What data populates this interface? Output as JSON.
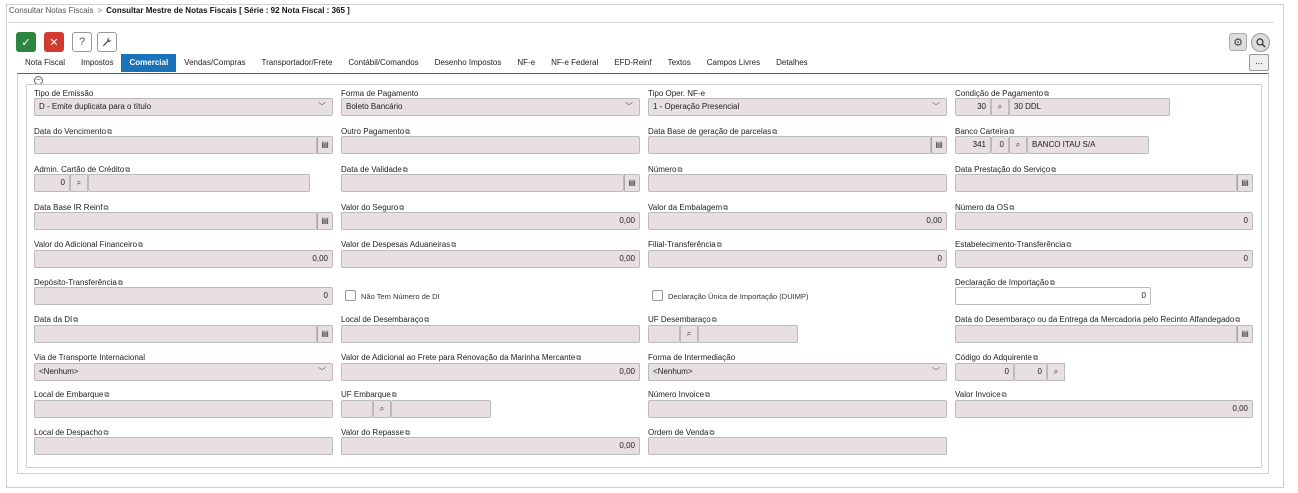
{
  "breadcrumb": {
    "parent": "Consultar Notas Fiscais",
    "separator": ">",
    "current": "Consultar Mestre de Notas Fiscais [ Série : 92 Nota Fiscal : 365 ]"
  },
  "toolbar": {
    "confirm_icon": "✓",
    "cancel_icon": "✕",
    "help_icon": "?",
    "tool_icon": "wrench",
    "gear_icon": "⚙",
    "search_icon": "⌕",
    "more_label": "..."
  },
  "tabs": [
    "Nota Fiscal",
    "Impostos",
    "Comercial",
    "Vendas/Compras",
    "Transportador/Frete",
    "Contábil/Comandos",
    "Desenho Impostos",
    "NF-e",
    "NF-e Federal",
    "EFD-Reinf",
    "Textos",
    "Campos Livres",
    "Detalhes"
  ],
  "active_tab": "Comercial",
  "colors": {
    "accent": "#1a73b8",
    "confirm": "#2e8540",
    "cancel": "#d13a2f",
    "field_bg": "#e7dfe1"
  },
  "form": {
    "tipo_emissao": {
      "label": "Tipo de Emissão",
      "value": "D - Emite duplicata para o título"
    },
    "forma_pagamento": {
      "label": "Forma de Pagamento",
      "value": "Boleto Bancário"
    },
    "tipo_oper_nfe": {
      "label": "Tipo Oper. NF-e",
      "value": "1 - Operação Presencial"
    },
    "condicao_pagamento": {
      "label": "Condição de Pagamento",
      "code": "30",
      "desc": "30 DDL"
    },
    "data_vencimento": {
      "label": "Data do Vencimento",
      "value": ""
    },
    "outro_pagamento": {
      "label": "Outro Pagamento",
      "value": ""
    },
    "data_base_parcelas": {
      "label": "Data Base de geração de parcelas",
      "value": ""
    },
    "banco_carteira": {
      "label": "Banco Carteira",
      "code": "341",
      "carteira": "0",
      "desc": "BANCO ITAU S/A"
    },
    "admin_cartao": {
      "label": "Admin. Cartão de Crédito",
      "code": "0",
      "desc": ""
    },
    "data_validade": {
      "label": "Data de Validade",
      "value": ""
    },
    "numero": {
      "label": "Número",
      "value": ""
    },
    "data_prestacao": {
      "label": "Data Prestação do Serviço",
      "value": ""
    },
    "data_base_ir": {
      "label": "Data Base IR Reinf",
      "value": ""
    },
    "valor_seguro": {
      "label": "Valor do Seguro",
      "value": "0,00"
    },
    "valor_embalagem": {
      "label": "Valor da Embalagem",
      "value": "0,00"
    },
    "numero_os": {
      "label": "Número da OS",
      "value": "0"
    },
    "valor_adicional_fin": {
      "label": "Valor do Adicional Financeiro",
      "value": "0,00"
    },
    "valor_despesas_adu": {
      "label": "Valor de Despesas Aduaneiras",
      "value": "0,00"
    },
    "filial_transf": {
      "label": "Filial-Transferência",
      "value": "0"
    },
    "estab_transf": {
      "label": "Estabelecimento-Transferência",
      "value": "0"
    },
    "deposito_transf": {
      "label": "Depósito-Transferência",
      "value": "0"
    },
    "nao_tem_di": {
      "label": "Não Tem Número de DI",
      "checked": false
    },
    "duimp": {
      "label": "Declaração Única de Importação (DUIMP)",
      "checked": false
    },
    "declaracao_importacao": {
      "label": "Declaração de Importação",
      "value": "0"
    },
    "data_di": {
      "label": "Data da DI",
      "value": ""
    },
    "local_desembaraco": {
      "label": "Local de Desembaraço",
      "value": ""
    },
    "uf_desembaraco": {
      "label": "UF Desembaraço",
      "code": "",
      "desc": ""
    },
    "data_desembaraco": {
      "label": "Data do Desembaraço ou da Entrega da Mercadoria pelo Recinto Alfandegado",
      "value": ""
    },
    "via_transporte": {
      "label": "Via de Transporte Internacional",
      "value": "<Nenhum>"
    },
    "valor_adicional_frete": {
      "label": "Valor de Adicional ao Frete para Renovação da Marinha Mercante",
      "value": "0,00"
    },
    "forma_intermediacao": {
      "label": "Forma de Intermediação",
      "value": "<Nenhum>"
    },
    "codigo_adquirente": {
      "label": "Código do Adquirente",
      "code1": "0",
      "code2": "0"
    },
    "local_embarque": {
      "label": "Local de Embarque",
      "value": ""
    },
    "uf_embarque": {
      "label": "UF Embarque",
      "code": "",
      "desc": ""
    },
    "numero_invoice": {
      "label": "Número Invoice",
      "value": ""
    },
    "valor_invoice": {
      "label": "Valor Invoice",
      "value": "0,00"
    },
    "local_despacho": {
      "label": "Local de Despacho",
      "value": ""
    },
    "valor_repasse": {
      "label": "Valor do Repasse",
      "value": "0,00"
    },
    "ordem_venda": {
      "label": "Ordem de Venda",
      "value": ""
    }
  }
}
